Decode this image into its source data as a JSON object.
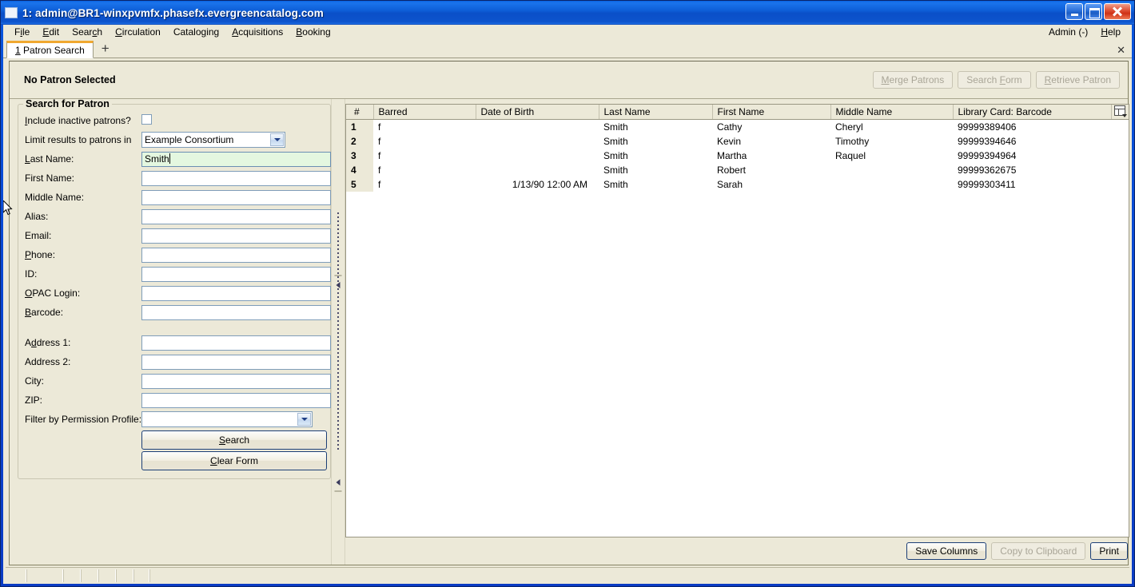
{
  "window": {
    "title": "1: admin@BR1-winxpvmfx.phasefx.evergreencatalog.com",
    "minimize_label": "",
    "maximize_label": "",
    "close_label": ""
  },
  "menubar": {
    "items": [
      {
        "pre": "F",
        "acc": "i",
        "post": "le"
      },
      {
        "pre": "",
        "acc": "E",
        "post": "dit"
      },
      {
        "pre": "Sear",
        "acc": "c",
        "post": "h"
      },
      {
        "pre": "",
        "acc": "C",
        "post": "irculation"
      },
      {
        "pre": "Catalo",
        "acc": "g",
        "post": "ing"
      },
      {
        "pre": "",
        "acc": "A",
        "post": "cquisitions"
      },
      {
        "pre": "",
        "acc": "B",
        "post": "ooking"
      }
    ],
    "right_items": [
      {
        "pre": "Admin (-)",
        "acc": "",
        "post": ""
      },
      {
        "pre": "",
        "acc": "H",
        "post": "elp"
      }
    ]
  },
  "tabs": {
    "active_number": "1",
    "active_label": "Patron Search",
    "new_tab_icon": "plus-icon",
    "close_icon": "close-icon"
  },
  "patron_header": {
    "status": "No Patron Selected",
    "buttons": [
      {
        "pre": "",
        "acc": "M",
        "post": "erge Patrons",
        "name": "merge-patrons-button",
        "disabled": true
      },
      {
        "pre": "Search ",
        "acc": "F",
        "post": "orm",
        "name": "search-form-button",
        "disabled": true
      },
      {
        "pre": "",
        "acc": "R",
        "post": "etrieve Patron",
        "name": "retrieve-patron-button",
        "disabled": true
      }
    ]
  },
  "search_form": {
    "group_title": "Search for Patron",
    "include_inactive": {
      "pre": "",
      "acc": "I",
      "post": "nclude inactive patrons?",
      "checked": false
    },
    "limit_results": {
      "label": "Limit results to patrons in",
      "value": "Example Consortium"
    },
    "fields": [
      {
        "pre": "",
        "acc": "L",
        "post": "ast Name:",
        "name": "last-name",
        "value": "Smith",
        "active": true
      },
      {
        "pre": "First Name:",
        "acc": "",
        "post": "",
        "name": "first-name",
        "value": "",
        "active": false
      },
      {
        "pre": "Middle Name:",
        "acc": "",
        "post": "",
        "name": "middle-name",
        "value": "",
        "active": false
      },
      {
        "pre": "Alias:",
        "acc": "",
        "post": "",
        "name": "alias",
        "value": "",
        "active": false
      },
      {
        "pre": "Email:",
        "acc": "",
        "post": "",
        "name": "email",
        "value": "",
        "active": false
      },
      {
        "pre": "",
        "acc": "P",
        "post": "hone:",
        "name": "phone",
        "value": "",
        "active": false
      },
      {
        "pre": "ID:",
        "acc": "",
        "post": "",
        "name": "id",
        "value": "",
        "active": false
      },
      {
        "pre": "",
        "acc": "O",
        "post": "PAC Login:",
        "name": "opac-login",
        "value": "",
        "active": false
      },
      {
        "pre": "",
        "acc": "B",
        "post": "arcode:",
        "name": "barcode",
        "value": "",
        "active": false
      }
    ],
    "address_fields": [
      {
        "pre": "A",
        "acc": "d",
        "post": "dress 1:",
        "name": "address-1",
        "value": ""
      },
      {
        "pre": "Address 2:",
        "acc": "",
        "post": "",
        "name": "address-2",
        "value": ""
      },
      {
        "pre": "City:",
        "acc": "",
        "post": "",
        "name": "city",
        "value": ""
      },
      {
        "pre": "ZIP:",
        "acc": "",
        "post": "",
        "name": "zip",
        "value": ""
      }
    ],
    "permission_profile": {
      "label": "Filter by Permission Profile:",
      "value": ""
    },
    "search_button": {
      "pre": "",
      "acc": "S",
      "post": "earch"
    },
    "clear_button": {
      "pre": "",
      "acc": "C",
      "post": "lear Form"
    }
  },
  "results": {
    "columns": [
      "#",
      "Barred",
      "Date of Birth",
      "Last Name",
      "First Name",
      "Middle Name",
      "Library Card: Barcode"
    ],
    "column_picker_icon": "column-picker-icon",
    "rows": [
      {
        "num": "1",
        "barred": "f",
        "dob": "",
        "last": "Smith",
        "first": "Cathy",
        "middle": "Cheryl",
        "barcode": "99999389406"
      },
      {
        "num": "2",
        "barred": "f",
        "dob": "",
        "last": "Smith",
        "first": "Kevin",
        "middle": "Timothy",
        "barcode": "99999394646"
      },
      {
        "num": "3",
        "barred": "f",
        "dob": "",
        "last": "Smith",
        "first": "Martha",
        "middle": "Raquel",
        "barcode": "99999394964"
      },
      {
        "num": "4",
        "barred": "f",
        "dob": "",
        "last": "Smith",
        "first": "Robert",
        "middle": "",
        "barcode": "99999362675"
      },
      {
        "num": "5",
        "barred": "f",
        "dob": "1/13/90 12:00 AM",
        "last": "Smith",
        "first": "Sarah",
        "middle": "",
        "barcode": "99999303411"
      }
    ],
    "actions": [
      {
        "label": "Save Columns",
        "name": "save-columns-button",
        "disabled": false
      },
      {
        "label": "Copy to Clipboard",
        "name": "copy-to-clipboard-button",
        "disabled": true
      },
      {
        "label": "Print",
        "name": "print-button",
        "disabled": false
      }
    ]
  },
  "colors": {
    "titlebar_blue": "#0a4fc8",
    "window_face": "#ece9d8",
    "active_field_green": "#e4f7e0",
    "tab_accent": "#f0a830",
    "field_border": "#7f9db9"
  }
}
